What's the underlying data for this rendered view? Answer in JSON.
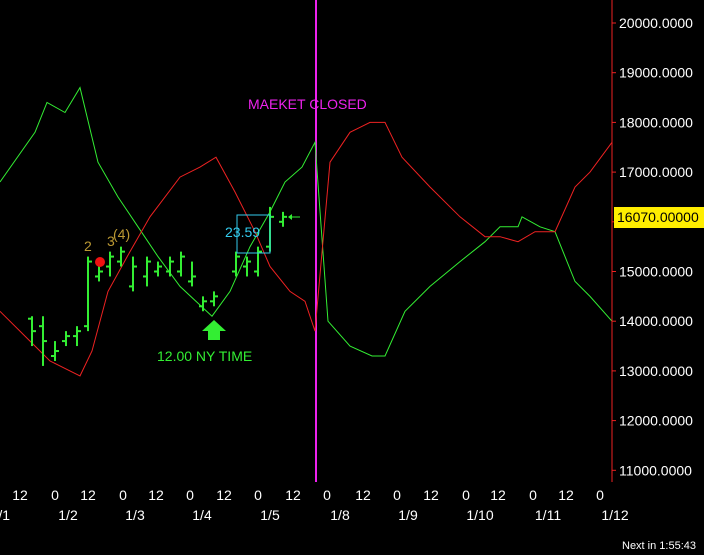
{
  "chart_data": {
    "type": "line",
    "title": "",
    "xlabel": "",
    "ylabel": "",
    "ylim": [
      11000,
      20000
    ],
    "y_ticks": [
      "11000.0000",
      "12000.0000",
      "13000.0000",
      "14000.0000",
      "15000.0000",
      "16000.0000",
      "17000.0000",
      "18000.0000",
      "19000.0000",
      "20000.0000"
    ],
    "x_ticks_hour": [
      "12",
      "0",
      "12",
      "0",
      "12",
      "0",
      "12",
      "0",
      "12",
      "0",
      "12",
      "0",
      "12",
      "0",
      "12",
      "0",
      "12",
      "0"
    ],
    "x_ticks_date": [
      "/1",
      "1/2",
      "1/3",
      "1/4",
      "1/5",
      "1/8",
      "1/9",
      "1/10",
      "1/11",
      "1/12"
    ],
    "current_price_label": "16070.00000",
    "grid": false,
    "series": [
      {
        "color": "#33ee33",
        "points": [
          [
            0,
            16800
          ],
          [
            35,
            17800
          ],
          [
            47,
            18400
          ],
          [
            65,
            18200
          ],
          [
            80,
            18700
          ],
          [
            98,
            17200
          ],
          [
            118,
            16500
          ],
          [
            138,
            15900
          ],
          [
            158,
            15300
          ],
          [
            180,
            14700
          ],
          [
            212,
            14100
          ],
          [
            230,
            14600
          ],
          [
            250,
            15500
          ],
          [
            270,
            16200
          ],
          [
            285,
            16800
          ],
          [
            302,
            17100
          ],
          [
            315,
            17600
          ],
          [
            328,
            14000
          ],
          [
            350,
            13500
          ],
          [
            372,
            13300
          ],
          [
            385,
            13300
          ],
          [
            405,
            14200
          ],
          [
            430,
            14700
          ],
          [
            460,
            15200
          ],
          [
            485,
            15600
          ],
          [
            500,
            15900
          ],
          [
            518,
            15900
          ],
          [
            522,
            16100
          ],
          [
            540,
            15900
          ],
          [
            555,
            15800
          ],
          [
            575,
            14800
          ],
          [
            590,
            14500
          ],
          [
            612,
            14000
          ]
        ]
      },
      {
        "color": "#ee2222",
        "points": [
          [
            0,
            14200
          ],
          [
            30,
            13600
          ],
          [
            50,
            13200
          ],
          [
            80,
            12900
          ],
          [
            92,
            13400
          ],
          [
            108,
            14600
          ],
          [
            130,
            15400
          ],
          [
            150,
            16100
          ],
          [
            180,
            16900
          ],
          [
            200,
            17100
          ],
          [
            216,
            17300
          ],
          [
            235,
            16600
          ],
          [
            255,
            15800
          ],
          [
            270,
            15100
          ],
          [
            290,
            14600
          ],
          [
            305,
            14400
          ],
          [
            315,
            13800
          ],
          [
            330,
            17200
          ],
          [
            350,
            17800
          ],
          [
            370,
            18000
          ],
          [
            385,
            18000
          ],
          [
            402,
            17300
          ],
          [
            430,
            16700
          ],
          [
            460,
            16100
          ],
          [
            485,
            15700
          ],
          [
            500,
            15700
          ],
          [
            518,
            15600
          ],
          [
            535,
            15800
          ],
          [
            555,
            15800
          ],
          [
            575,
            16700
          ],
          [
            590,
            17000
          ],
          [
            612,
            17600
          ]
        ]
      }
    ],
    "ohlc_bars": [
      [
        32,
        14100,
        13500,
        14050,
        13800
      ],
      [
        43,
        14100,
        13100,
        13900,
        13600
      ],
      [
        55,
        13600,
        13200,
        13300,
        13400
      ],
      [
        66,
        13800,
        13500,
        13600,
        13700
      ],
      [
        77,
        13900,
        13500,
        13700,
        13800
      ],
      [
        88,
        15300,
        13800,
        13900,
        15200
      ],
      [
        99,
        15100,
        14800,
        14900,
        15000
      ],
      [
        110,
        15400,
        14900,
        15100,
        15300
      ],
      [
        121,
        15500,
        15100,
        15200,
        15400
      ],
      [
        133,
        15300,
        14600,
        14700,
        15100
      ],
      [
        147,
        15300,
        14700,
        14900,
        15200
      ],
      [
        158,
        15200,
        14900,
        15000,
        15100
      ],
      [
        170,
        15300,
        14900,
        15000,
        15200
      ],
      [
        181,
        15400,
        14900,
        15000,
        15300
      ],
      [
        192,
        15200,
        14700,
        14800,
        14900
      ],
      [
        203,
        14500,
        14200,
        14300,
        14400
      ],
      [
        214,
        14600,
        14300,
        14400,
        14500
      ],
      [
        236,
        15400,
        14900,
        15000,
        15300
      ],
      [
        247,
        15300,
        14900,
        15100,
        15200
      ],
      [
        258,
        15500,
        14900,
        15000,
        15400
      ],
      [
        270,
        16300,
        15400,
        15500,
        16100
      ],
      [
        283,
        16200,
        15900,
        16000,
        16100
      ]
    ],
    "annotations": [
      {
        "text": "MAEKET CLOSED",
        "color": "#ee22ee"
      },
      {
        "text": "12.00 NY TIME",
        "color": "#33ee33"
      },
      {
        "text": "23.59",
        "color": "#33ccee"
      },
      {
        "text": "2",
        "color": "#bb9933"
      },
      {
        "text": "3",
        "color": "#bb9933"
      },
      {
        "text": "(4)",
        "color": "#bb9933"
      }
    ],
    "colors": {
      "background": "#000000",
      "price_axis": "#ee2222",
      "market_closed_line": "#ee22ee",
      "price_label_bg": "#ffee00"
    }
  },
  "status": {
    "next_update": "Next in 1:55:43"
  }
}
